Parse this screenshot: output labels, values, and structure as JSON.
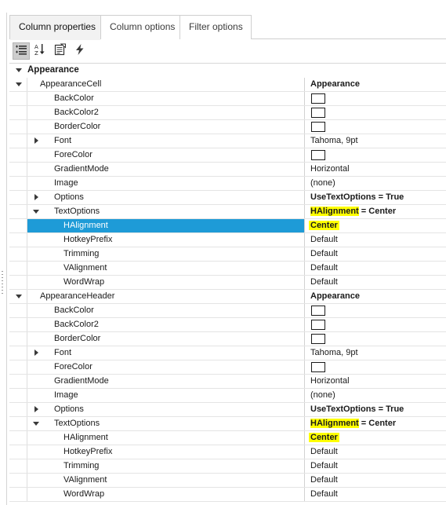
{
  "window": {
    "title": "Column properties"
  },
  "tabs": [
    {
      "label": "Column properties",
      "active": true
    },
    {
      "label": "Column options",
      "active": false
    },
    {
      "label": "Filter options",
      "active": false
    }
  ],
  "toolbar": {
    "buttons": [
      {
        "icon": "categorized-view-icon",
        "title": "Categorized",
        "pressed": true
      },
      {
        "icon": "alphabetical-sort-icon",
        "title": "Alphabetical",
        "pressed": false
      },
      {
        "icon": "property-pages-icon",
        "title": "Property Pages",
        "pressed": false
      },
      {
        "icon": "events-lightning-icon",
        "title": "Events",
        "pressed": false
      }
    ]
  },
  "grid": {
    "rows": [
      {
        "name": "Appearance",
        "level": "cat",
        "expander": "open",
        "value": "",
        "kind": "category"
      },
      {
        "name": "AppearanceCell",
        "level": 0,
        "expander": "open",
        "value": "Appearance",
        "kind": "text",
        "value_bold": true
      },
      {
        "name": "BackColor",
        "level": 1,
        "expander": "",
        "value": "",
        "kind": "swatch",
        "swatch_color": "#ffffff"
      },
      {
        "name": "BackColor2",
        "level": 1,
        "expander": "",
        "value": "",
        "kind": "swatch",
        "swatch_color": "#ffffff"
      },
      {
        "name": "BorderColor",
        "level": 1,
        "expander": "",
        "value": "",
        "kind": "swatch",
        "swatch_color": "#ffffff"
      },
      {
        "name": "Font",
        "level": 1,
        "expander": "closed",
        "value": "Tahoma, 9pt",
        "kind": "text"
      },
      {
        "name": "ForeColor",
        "level": 1,
        "expander": "",
        "value": "",
        "kind": "swatch",
        "swatch_color": "#ffffff"
      },
      {
        "name": "GradientMode",
        "level": 1,
        "expander": "",
        "value": "Horizontal",
        "kind": "text"
      },
      {
        "name": "Image",
        "level": 1,
        "expander": "",
        "value": "(none)",
        "kind": "text"
      },
      {
        "name": "Options",
        "level": 1,
        "expander": "closed",
        "value": "UseTextOptions = True",
        "kind": "text",
        "value_bold": true
      },
      {
        "name": "TextOptions",
        "level": 1,
        "expander": "open",
        "value": "HAlignment = Center",
        "kind": "text",
        "value_bold": true,
        "highlight_prefix": "HAlignment"
      },
      {
        "name": "HAlignment",
        "level": 2,
        "expander": "",
        "value": "Center",
        "kind": "text",
        "value_bold": true,
        "highlight": true,
        "selected": true
      },
      {
        "name": "HotkeyPrefix",
        "level": 2,
        "expander": "",
        "value": "Default",
        "kind": "text"
      },
      {
        "name": "Trimming",
        "level": 2,
        "expander": "",
        "value": "Default",
        "kind": "text"
      },
      {
        "name": "VAlignment",
        "level": 2,
        "expander": "",
        "value": "Default",
        "kind": "text"
      },
      {
        "name": "WordWrap",
        "level": 2,
        "expander": "",
        "value": "Default",
        "kind": "text"
      },
      {
        "name": "AppearanceHeader",
        "level": 0,
        "expander": "open",
        "value": "Appearance",
        "kind": "text",
        "value_bold": true
      },
      {
        "name": "BackColor",
        "level": 1,
        "expander": "",
        "value": "",
        "kind": "swatch",
        "swatch_color": "#ffffff"
      },
      {
        "name": "BackColor2",
        "level": 1,
        "expander": "",
        "value": "",
        "kind": "swatch",
        "swatch_color": "#ffffff"
      },
      {
        "name": "BorderColor",
        "level": 1,
        "expander": "",
        "value": "",
        "kind": "swatch",
        "swatch_color": "#ffffff"
      },
      {
        "name": "Font",
        "level": 1,
        "expander": "closed",
        "value": "Tahoma, 9pt",
        "kind": "text"
      },
      {
        "name": "ForeColor",
        "level": 1,
        "expander": "",
        "value": "",
        "kind": "swatch",
        "swatch_color": "#ffffff"
      },
      {
        "name": "GradientMode",
        "level": 1,
        "expander": "",
        "value": "Horizontal",
        "kind": "text"
      },
      {
        "name": "Image",
        "level": 1,
        "expander": "",
        "value": "(none)",
        "kind": "text"
      },
      {
        "name": "Options",
        "level": 1,
        "expander": "closed",
        "value": "UseTextOptions = True",
        "kind": "text",
        "value_bold": true
      },
      {
        "name": "TextOptions",
        "level": 1,
        "expander": "open",
        "value": "HAlignment = Center",
        "kind": "text",
        "value_bold": true,
        "highlight_prefix": "HAlignment"
      },
      {
        "name": "HAlignment",
        "level": 2,
        "expander": "",
        "value": "Center",
        "kind": "text",
        "value_bold": true,
        "highlight": true
      },
      {
        "name": "HotkeyPrefix",
        "level": 2,
        "expander": "",
        "value": "Default",
        "kind": "text"
      },
      {
        "name": "Trimming",
        "level": 2,
        "expander": "",
        "value": "Default",
        "kind": "text"
      },
      {
        "name": "VAlignment",
        "level": 2,
        "expander": "",
        "value": "Default",
        "kind": "text"
      },
      {
        "name": "WordWrap",
        "level": 2,
        "expander": "",
        "value": "Default",
        "kind": "text"
      }
    ]
  },
  "colors": {
    "selection": "#1e9bd7",
    "highlight": "#ffff00",
    "tab_active_bg": "#f2f2f2",
    "grid_line": "#e4e4e4"
  }
}
